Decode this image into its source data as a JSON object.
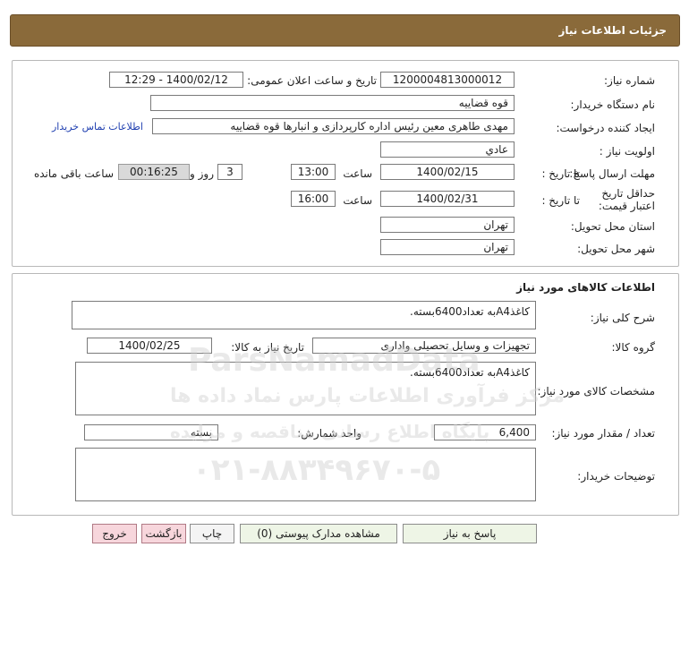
{
  "header": {
    "title": "جزئیات اطلاعات نیاز"
  },
  "need": {
    "need_no_label": "شماره نیاز:",
    "need_no": "1200004813000012",
    "announce_label": "تاریخ و ساعت اعلان عمومی:",
    "announce": "1400/02/12 - 12:29",
    "buyer_label": "نام دستگاه خریدار:",
    "buyer": "قوه قضاییه",
    "creator_label": "ایجاد کننده درخواست:",
    "creator": "مهدی طاهری معین رئیس اداره کارپردازی و انبارها قوه قضاییه",
    "contact_link": "اطلاعات تماس خریدار",
    "priority_label": "اولویت نیاز :",
    "priority": "عادي",
    "send_deadline_label": "مهلت ارسال پاسخ:",
    "until_date_label": "تا تاریخ :",
    "send_date": "1400/02/15",
    "time_label": "ساعت",
    "send_time": "13:00",
    "days": "3",
    "days_label": "روز و",
    "remaining": "00:16:25",
    "remaining_label": "ساعت باقی مانده",
    "validity_label": "حداقل تاریخ اعتبار قیمت:",
    "validity_until_label": "تا تاریخ :",
    "validity_date": "1400/02/31",
    "validity_time_label": "ساعت",
    "validity_time": "16:00",
    "province_label": "استان محل تحویل:",
    "province": "تهران",
    "city_label": "شهر محل تحویل:",
    "city": "تهران"
  },
  "goods": {
    "section_title": "اطلاعات کالاهای مورد نیاز",
    "summary_label": "شرح کلی نیاز:",
    "summary": "کاغذA4به تعداد6400بسته.",
    "group_label": "گروه کالا:",
    "group": "تجهیزات و وسایل تحصیلی واداری",
    "need_date_label": "تاریخ نیاز به کالا:",
    "need_date": "1400/02/25",
    "specs_label": "مشخصات کالای مورد نیاز:",
    "specs": "کاغذA4به تعداد6400بسته.",
    "qty_label": "تعداد / مقدار مورد نیاز:",
    "qty": "6,400",
    "unit_label": "واحد شمارش:",
    "unit": "بسته",
    "notes_label": "توضیحات خریدار:",
    "notes": ""
  },
  "buttons": {
    "reply": "پاسخ به نیاز",
    "attachments": "مشاهده مدارک پیوستی (0)",
    "print": "چاپ",
    "back": "بازگشت",
    "exit": "خروج"
  },
  "watermark": {
    "brand": "ParsNamadData",
    "line1": "مرکز فرآوری اطلاعات پارس نماد داده ها",
    "line2": "پایگاه اطلاع رسانی مناقصه و مزایده",
    "phone": "۰۲۱-۸۸۳۴۹۶۷۰-۵"
  }
}
